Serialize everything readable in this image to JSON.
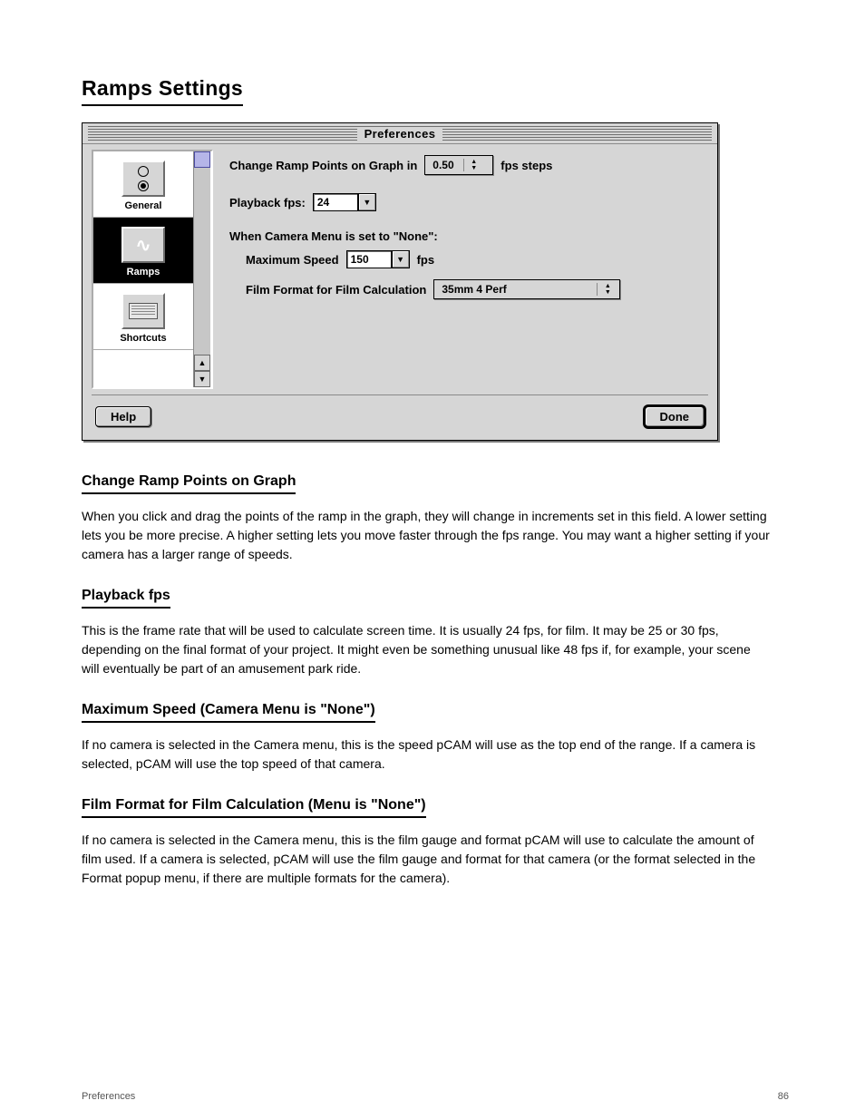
{
  "heading_ramps": "Ramps Settings",
  "dialog": {
    "title": "Preferences",
    "sidebar": {
      "items": [
        {
          "label": "General",
          "icon": "radio-buttons-icon"
        },
        {
          "label": "Ramps",
          "icon": "ramp-curve-icon"
        },
        {
          "label": "Shortcuts",
          "icon": "keyboard-icon"
        }
      ],
      "selected_index": 1
    },
    "content": {
      "change_ramp_label_pre": "Change Ramp Points on Graph in",
      "change_ramp_value": "0.50",
      "change_ramp_label_post": "fps steps",
      "playback_label": "Playback fps:",
      "playback_value": "24",
      "none_heading": "When Camera Menu is set to \"None\":",
      "max_speed_label": "Maximum Speed",
      "max_speed_value": "150",
      "max_speed_unit": "fps",
      "film_format_label": "Film Format for Film Calculation",
      "film_format_value": "35mm 4 Perf"
    },
    "buttons": {
      "help": "Help",
      "done": "Done"
    }
  },
  "doc": {
    "h_change_ramp": "Change Ramp Points on Graph",
    "p_change_ramp": "When you click and drag the points of the ramp in the graph, they will change in increments set in this field. A lower setting lets you be more precise. A higher setting lets you move faster through the fps range. You may want a higher setting if your camera has a larger range of speeds.",
    "h_playback": "Playback fps",
    "p_playback": "This is the frame rate that will be used to calculate screen time. It is usually 24 fps, for film. It may be 25 or 30 fps, depending on the final format of your project. It might even be something unusual like 48 fps if, for example, your scene will eventually be part of an amusement park ride.",
    "h_max_speed": "Maximum Speed (Camera Menu is \"None\")",
    "p_max_speed": "If no camera is selected in the Camera menu, this is the speed pCAM will use as the top end of the range. If a camera is selected, pCAM will use the top speed of that camera.",
    "h_film_format": "Film Format for Film Calculation (Menu is \"None\")",
    "p_film_format": "If no camera is selected in the Camera menu, this is the film gauge and format pCAM will use to calculate the amount of film used. If a camera is selected, pCAM will use the film gauge and format for that camera (or the format selected in the Format popup menu, if there are multiple formats for the camera).",
    "footer_left": "Preferences",
    "footer_right": "86"
  }
}
